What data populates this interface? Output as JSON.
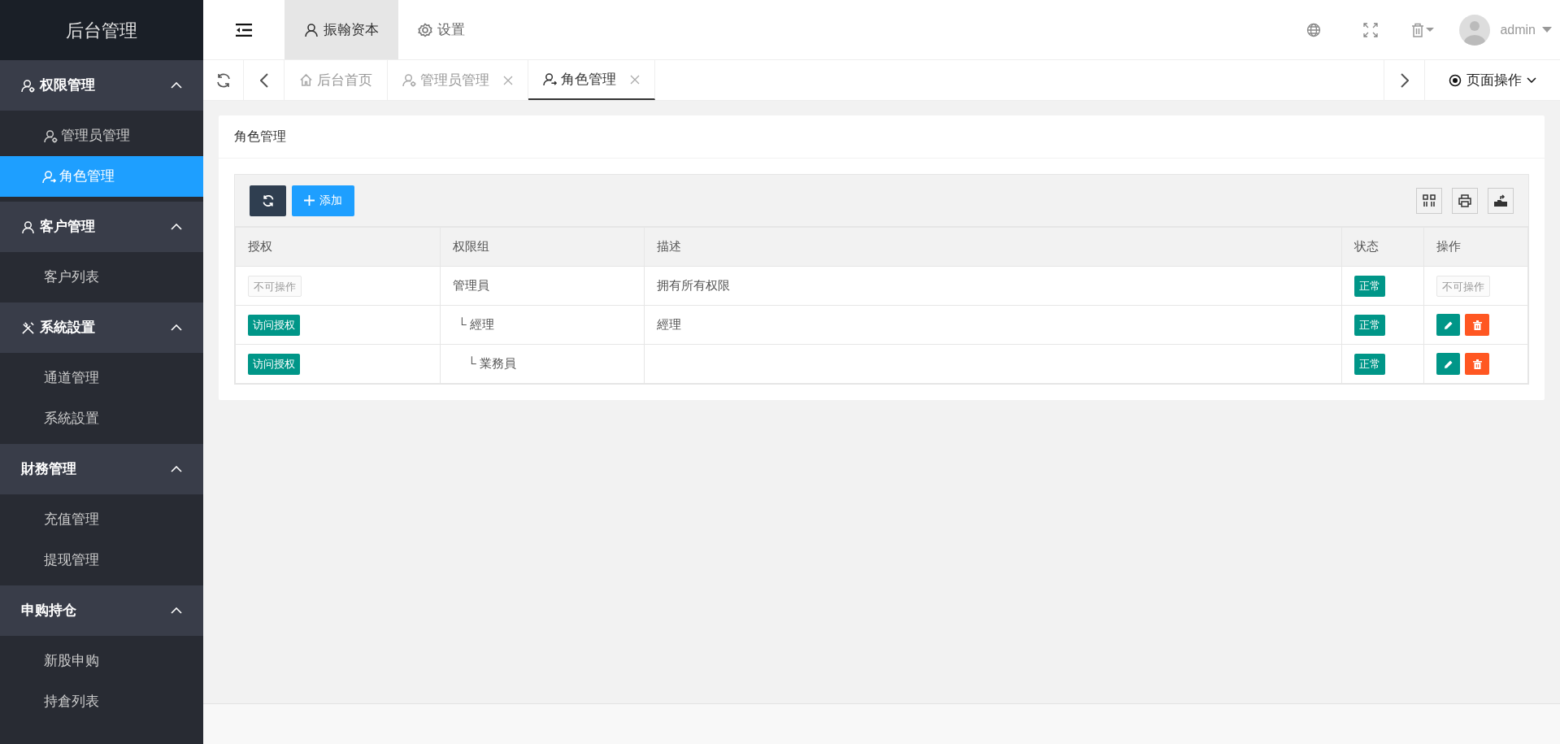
{
  "app_title": "后台管理",
  "header": {
    "nav": [
      {
        "label": "振翰资本",
        "kind": "user",
        "selected": true
      },
      {
        "label": "设置",
        "kind": "gear",
        "selected": false
      }
    ],
    "user": "admin"
  },
  "sidebar": {
    "groups": [
      {
        "label": "权限管理",
        "kind": "user-gear",
        "expanded": true,
        "items": [
          {
            "label": "管理员管理",
            "kind": "user-gear",
            "selected": false
          },
          {
            "label": "角色管理",
            "kind": "user-arrow",
            "selected": true
          }
        ]
      },
      {
        "label": "客户管理",
        "kind": "user",
        "expanded": true,
        "items": [
          {
            "label": "客户列表",
            "selected": false
          }
        ]
      },
      {
        "label": "系統設置",
        "kind": "tools",
        "expanded": true,
        "items": [
          {
            "label": "通道管理",
            "selected": false
          },
          {
            "label": "系統設置",
            "selected": false
          }
        ]
      },
      {
        "label": "財務管理",
        "expanded": true,
        "items": [
          {
            "label": "充值管理",
            "selected": false
          },
          {
            "label": "提现管理",
            "selected": false
          }
        ]
      },
      {
        "label": "申购持仓",
        "expanded": true,
        "items": [
          {
            "label": "新股申购",
            "selected": false
          },
          {
            "label": "持倉列表",
            "selected": false
          }
        ]
      }
    ]
  },
  "tabs": [
    {
      "label": "后台首页",
      "kind": "home",
      "closable": false,
      "selected": false
    },
    {
      "label": "管理员管理",
      "kind": "user-gear",
      "closable": true,
      "selected": false
    },
    {
      "label": "角色管理",
      "kind": "user-arrow",
      "closable": true,
      "selected": true
    }
  ],
  "page_actions": "页面操作",
  "card": {
    "title": "角色管理",
    "add_button": "添加",
    "table": {
      "columns": [
        "授权",
        "权限组",
        "描述",
        "状态",
        "操作"
      ],
      "rows": [
        {
          "auth": {
            "label": "不可操作",
            "disabled": true
          },
          "name": "管理員",
          "description": "拥有所有权限",
          "status": "正常",
          "actions": {
            "disabled": true,
            "label": "不可操作"
          },
          "children": [
            {
              "auth": {
                "label": "访问授权",
                "disabled": false
              },
              "branch": "└",
              "name": "經理",
              "description": "經理",
              "status": "正常",
              "actions": {
                "disabled": false
              },
              "children": [
                {
                  "auth": {
                    "label": "访问授权",
                    "disabled": false
                  },
                  "branch": "└",
                  "name": "業務員",
                  "status": "正常",
                  "actions": {
                    "disabled": false
                  }
                }
              ]
            }
          ]
        }
      ]
    }
  }
}
